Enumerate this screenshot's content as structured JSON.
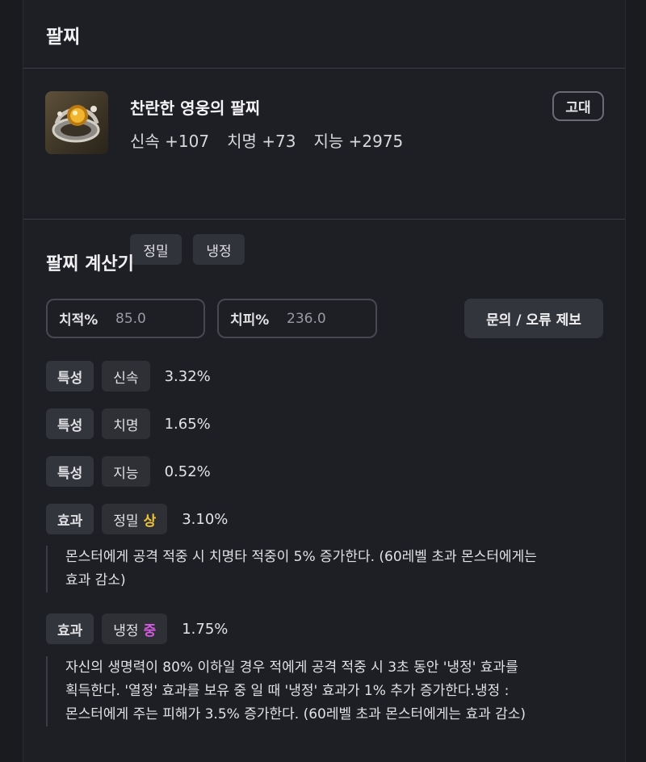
{
  "header": {
    "title": "팔찌"
  },
  "item": {
    "name": "찬란한 영웅의 팔찌",
    "grade": "고대",
    "stats": [
      {
        "label": "신속 +107"
      },
      {
        "label": "치명 +73"
      },
      {
        "label": "지능 +2975"
      }
    ],
    "tags": [
      "정밀",
      "냉정"
    ]
  },
  "calculator": {
    "title": "팔찌 계산기",
    "crit_rate": {
      "label": "치적%",
      "value": "85.0"
    },
    "crit_damage": {
      "label": "치피%",
      "value": "236.0"
    },
    "report_button": "문의 / 오류 제보",
    "rows": [
      {
        "kind": "특성",
        "name": "신속",
        "value": "3.32%"
      },
      {
        "kind": "특성",
        "name": "치명",
        "value": "1.65%"
      },
      {
        "kind": "특성",
        "name": "지능",
        "value": "0.52%"
      },
      {
        "kind": "효과",
        "name": "정밀",
        "tier": "상",
        "value": "3.10%",
        "tier_color": "#f0c43a",
        "desc_lines": [
          "몬스터에게 공격 적중 시 치명타 적중이 5% 증가한다. (60레벨 초과 몬스터에게는",
          "효과 감소)"
        ]
      },
      {
        "kind": "효과",
        "name": "냉정",
        "tier": "중",
        "value": "1.75%",
        "tier_color": "#d65be0",
        "desc_lines": [
          "자신의 생명력이 80% 이하일 경우 적에게 공격 적중 시 3초 동안 '냉정' 효과를",
          "획득한다. '열정' 효과를 보유 중 일 때 '냉정' 효과가 1% 추가 증가한다.냉정 :",
          "몬스터에게 주는 피해가 3.5% 증가한다. (60레벨 초과 몬스터에게는 효과 감소)"
        ]
      }
    ]
  }
}
